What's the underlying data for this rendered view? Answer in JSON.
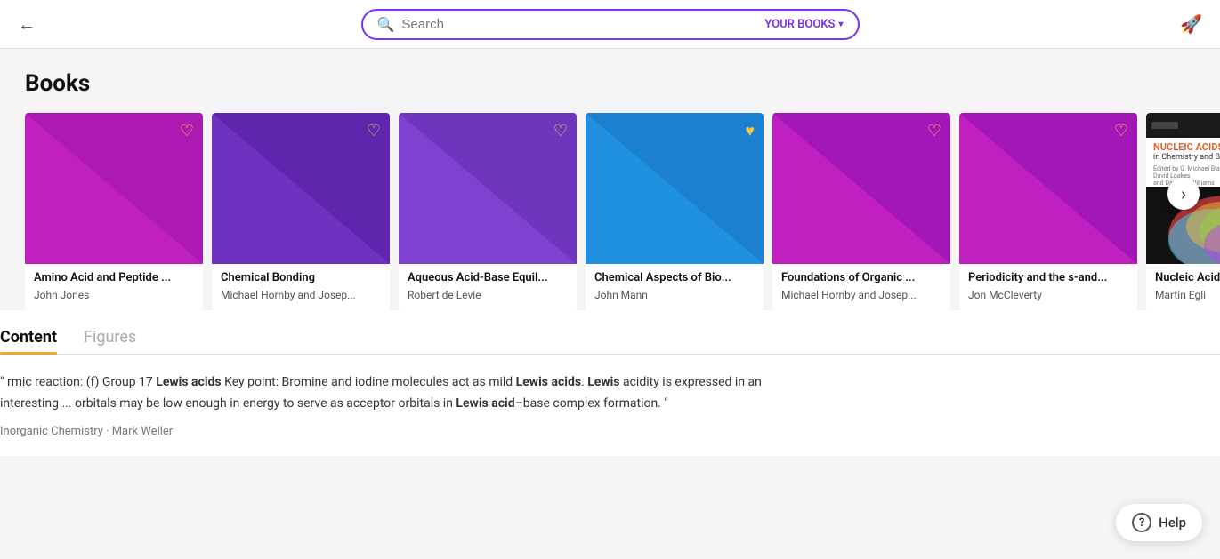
{
  "header": {
    "back_label": "←",
    "search_placeholder": "Search",
    "scope_label": "YOUR BOOKS",
    "scope_arrow": "▾",
    "rocket_icon": "🚀"
  },
  "books_section": {
    "title": "Books",
    "books": [
      {
        "title": "Amino Acid and Peptide ...",
        "author": "John Jones",
        "color1": "#c020c0",
        "color2": "#9010b0",
        "heart_filled": false,
        "heart_color": "#f5c542"
      },
      {
        "title": "Chemical Bonding",
        "author": "Michael Hornby and Josep...",
        "color1": "#7030c0",
        "color2": "#5020a0",
        "heart_filled": false,
        "heart_color": "#f5c542"
      },
      {
        "title": "Aqueous Acid-Base Equil...",
        "author": "Robert de Levie",
        "color1": "#8040d0",
        "color2": "#6030b0",
        "heart_filled": false,
        "heart_color": "#f5c542"
      },
      {
        "title": "Chemical Aspects of Bio...",
        "author": "John Mann",
        "color1": "#2090e0",
        "color2": "#1870c0",
        "heart_filled": true,
        "heart_color": "#f5c542"
      },
      {
        "title": "Foundations of Organic ...",
        "author": "Michael Hornby and Josep...",
        "color1": "#c020c0",
        "color2": "#9010b0",
        "heart_filled": false,
        "heart_color": "#f5c542"
      },
      {
        "title": "Periodicity and the s-and...",
        "author": "Jon McCleverty",
        "color1": "#c020c0",
        "color2": "#9010b0",
        "heart_filled": false,
        "heart_color": "#f5c542"
      }
    ],
    "partial_book": {
      "title": "Nucleic Acids in Chemis...",
      "author": "Martin Egli",
      "heart_filled": false,
      "heart_color": "#f5c542"
    },
    "next_button": "›"
  },
  "content_section": {
    "tabs": [
      {
        "label": "Content",
        "active": true
      },
      {
        "label": "Figures",
        "active": false
      }
    ],
    "text_parts": [
      {
        "text": "\" rmic reaction: (f) Group 17 ",
        "bold": false
      },
      {
        "text": "Lewis acids",
        "bold": true
      },
      {
        "text": " Key point: Bromine and iodine molecules act as mild ",
        "bold": false
      },
      {
        "text": "Lewis acids",
        "bold": true
      },
      {
        "text": ". ",
        "bold": false
      },
      {
        "text": "Lewis",
        "bold": true
      },
      {
        "text": " acidity is expressed in an interesting ... orbitals may be low enough in energy to serve as acceptor orbitals in ",
        "bold": false
      },
      {
        "text": "Lewis acid",
        "bold": true
      },
      {
        "text": "–base complex formation. \"",
        "bold": false
      }
    ],
    "source": "Inorganic Chemistry · Mark Weller"
  },
  "help": {
    "label": "Help"
  }
}
